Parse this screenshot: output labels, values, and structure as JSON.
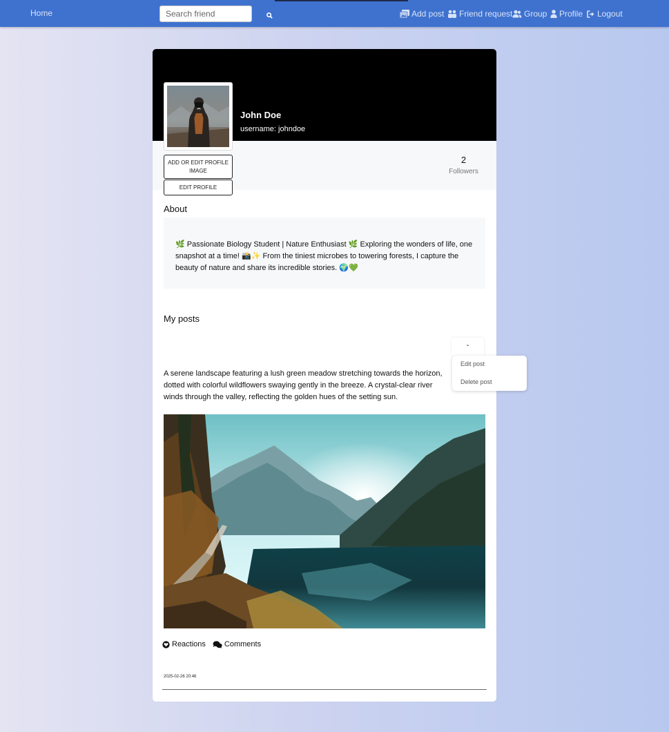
{
  "navbar": {
    "home_label": "Home",
    "search_placeholder": "Search friend",
    "add_post_label": "Add post",
    "friend_request_label": "Friend request",
    "group_label": "Group",
    "profile_label": "Profile",
    "logout_label": "Logout",
    "accent_color": "#3f72cf"
  },
  "profile": {
    "name": "John Doe",
    "username": "username: johndoe",
    "add_image_button": "ADD OR EDIT PROFILE IMAGE",
    "edit_profile_button": "EDIT PROFILE",
    "followers_count": "2",
    "followers_label": "Followers"
  },
  "about": {
    "title": "About",
    "text": "🌿 Passionate Biology Student | Nature Enthusiast 🌿 Exploring the wonders of life, one snapshot at a time! 📸✨ From the tiniest microbes to towering forests, I capture the beauty of nature and share its incredible stories. 🌍💚"
  },
  "posts": {
    "title": "My posts",
    "items": [
      {
        "menu_button": "-",
        "text": "A serene landscape featuring a lush green meadow stretching towards the horizon, dotted with colorful wildflowers swaying gently in the breeze. A crystal-clear river winds through the valley, reflecting the golden hues of the setting sun.",
        "reactions_label": "Reactions",
        "comments_label": "Comments",
        "timestamp": "2025-02-26 20:46"
      }
    ]
  },
  "post_menu": {
    "edit_label": "Edit post",
    "delete_label": "Delete post"
  },
  "icons": {
    "search": "search-icon",
    "add_post": "images-icon",
    "friend_request": "user-friends-icon",
    "group": "users-icon",
    "profile": "user-icon",
    "logout": "sign-out-icon",
    "reactions": "heart-icon",
    "comments": "comments-icon"
  }
}
